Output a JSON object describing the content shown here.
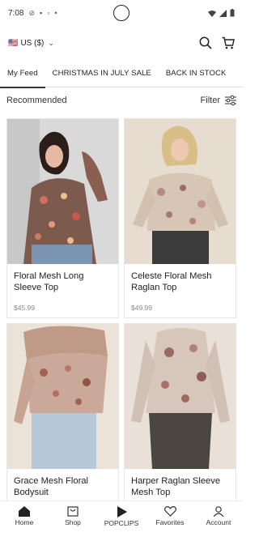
{
  "status": {
    "time": "7:08"
  },
  "currency": {
    "flag": "🇺🇸",
    "label": "US ($)"
  },
  "tabs": [
    {
      "label": "My Feed"
    },
    {
      "label": "CHRISTMAS IN JULY SALE"
    },
    {
      "label": "BACK IN STOCK"
    }
  ],
  "section": {
    "title": "Recommended",
    "filter_label": "Filter"
  },
  "products": [
    {
      "name": "Floral Mesh Long Sleeve Top",
      "price": "$45.99"
    },
    {
      "name": "Celeste Floral Mesh Raglan Top",
      "price": "$49.99"
    },
    {
      "name": "Grace Mesh Floral Bodysuit",
      "price": ""
    },
    {
      "name": "Harper Raglan Sleeve Mesh Top",
      "price": ""
    }
  ],
  "nav": [
    {
      "label": "Home",
      "icon": "home-icon"
    },
    {
      "label": "Shop",
      "icon": "shop-icon"
    },
    {
      "label": "POPCLIPS",
      "icon": "play-icon"
    },
    {
      "label": "Favorites",
      "icon": "heart-icon"
    },
    {
      "label": "Account",
      "icon": "person-icon"
    }
  ]
}
